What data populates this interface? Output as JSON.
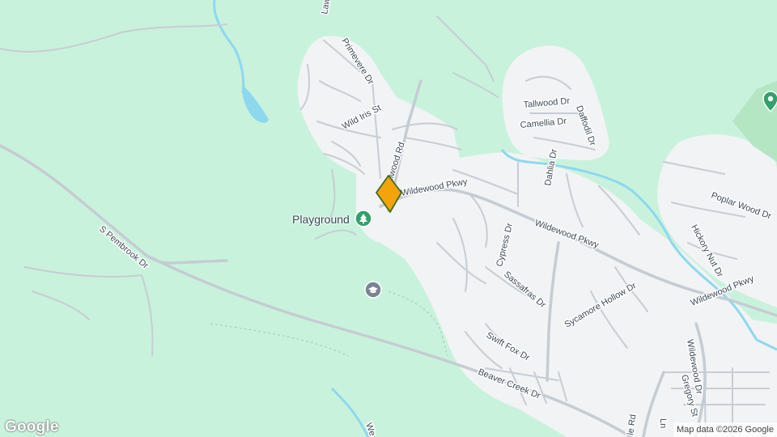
{
  "map": {
    "colors": {
      "park": "#c9f2dd",
      "residential": "#f1f3f4",
      "road": "#c7cdd4",
      "water": "#8ed8ee",
      "green_area": "#b4e6c4",
      "marker": "#f4a40b",
      "poi": "#34a06c",
      "school": "#7a8592"
    },
    "streets": [
      {
        "id": "lawn",
        "text": "Lawn"
      },
      {
        "id": "primevere",
        "text": "Primevere Dr"
      },
      {
        "id": "wild-iris",
        "text": "Wild Iris St"
      },
      {
        "id": "wildwood-rd",
        "text": "llwood Rd"
      },
      {
        "id": "wildewood-pkwy-1",
        "text": "Wildewood Pkwy"
      },
      {
        "id": "wildewood-pkwy-2",
        "text": "Wildewood Pkwy"
      },
      {
        "id": "wildewood-pkwy-3",
        "text": "Wildewood Pkwy"
      },
      {
        "id": "tallwood",
        "text": "Tallwood Dr"
      },
      {
        "id": "camellia",
        "text": "Camellia Dr"
      },
      {
        "id": "daffodil",
        "text": "Daffodil Dr"
      },
      {
        "id": "dahlia",
        "text": "Dahlia Dr"
      },
      {
        "id": "cypress",
        "text": "Cypress Dr"
      },
      {
        "id": "sassafras",
        "text": "Sassafras Dr"
      },
      {
        "id": "sycamore",
        "text": "Sycamore Hollow Dr"
      },
      {
        "id": "swift-fox",
        "text": "Swift Fox Dr"
      },
      {
        "id": "beaver-creek",
        "text": "Beaver Creek Dr"
      },
      {
        "id": "poplar-wood",
        "text": "Poplar Wood Dr"
      },
      {
        "id": "hickory-nut",
        "text": "Hickory Nut Dr"
      },
      {
        "id": "wildewood-dr",
        "text": "Wildewood Dr"
      },
      {
        "id": "gregory",
        "text": "Gregory St"
      },
      {
        "id": "pembrook",
        "text": "S Pembrook Dr"
      },
      {
        "id": "le-rd",
        "text": "le Rd"
      },
      {
        "id": "ln-frag",
        "text": "Ln"
      },
      {
        "id": "we-frag",
        "text": "We"
      }
    ],
    "poi": {
      "name": "Playground",
      "icon": "tree-icon"
    },
    "school_icon": "graduation-cap-icon",
    "place_icon": "location-pin-icon",
    "marker_icon": "selected-location-marker"
  },
  "footer": {
    "logo": "Google",
    "attribution": "Map data ©2026 Google"
  }
}
